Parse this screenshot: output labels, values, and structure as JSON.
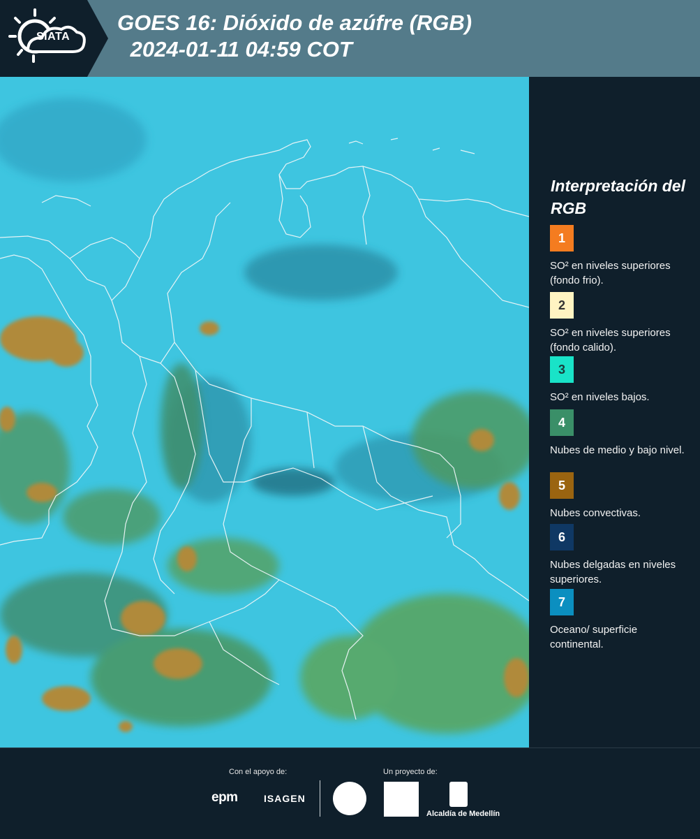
{
  "header": {
    "logo_text": "SIATA",
    "title": "GOES 16: Dióxido de azúfre (RGB)",
    "subtitle": " 2024-01-11 04:59 COT"
  },
  "legend": {
    "title": "Interpretación del RGB",
    "items": [
      {
        "number": "1",
        "color": "#f47c20",
        "text_color": "#ffffff",
        "label": "SO² en niveles superiores (fondo frio)."
      },
      {
        "number": "2",
        "color": "#fff4c2",
        "text_color": "#333333",
        "label": "SO² en niveles superiores (fondo calido)."
      },
      {
        "number": "3",
        "color": "#19e3c8",
        "text_color": "#1a3b3a",
        "label": "SO² en niveles bajos."
      },
      {
        "number": "4",
        "color": "#3a8f68",
        "text_color": "#ffffff",
        "label": "Nubes de medio y bajo nivel."
      },
      {
        "number": "5",
        "color": "#9a6410",
        "text_color": "#ffffff",
        "label": "Nubes convectivas."
      },
      {
        "number": "6",
        "color": "#0f3864",
        "text_color": "#ffffff",
        "label": "Nubes delgadas en niveles superiores."
      },
      {
        "number": "7",
        "color": "#0b8fc0",
        "text_color": "#ffffff",
        "label": "Oceano/ superficie continental."
      }
    ]
  },
  "footer": {
    "support_label": "Con el apoyo de:",
    "project_label": "Un proyecto de:",
    "epm": "epm",
    "isagen": "ISAGEN",
    "alcaldia": "Alcaldía de Medellín"
  }
}
